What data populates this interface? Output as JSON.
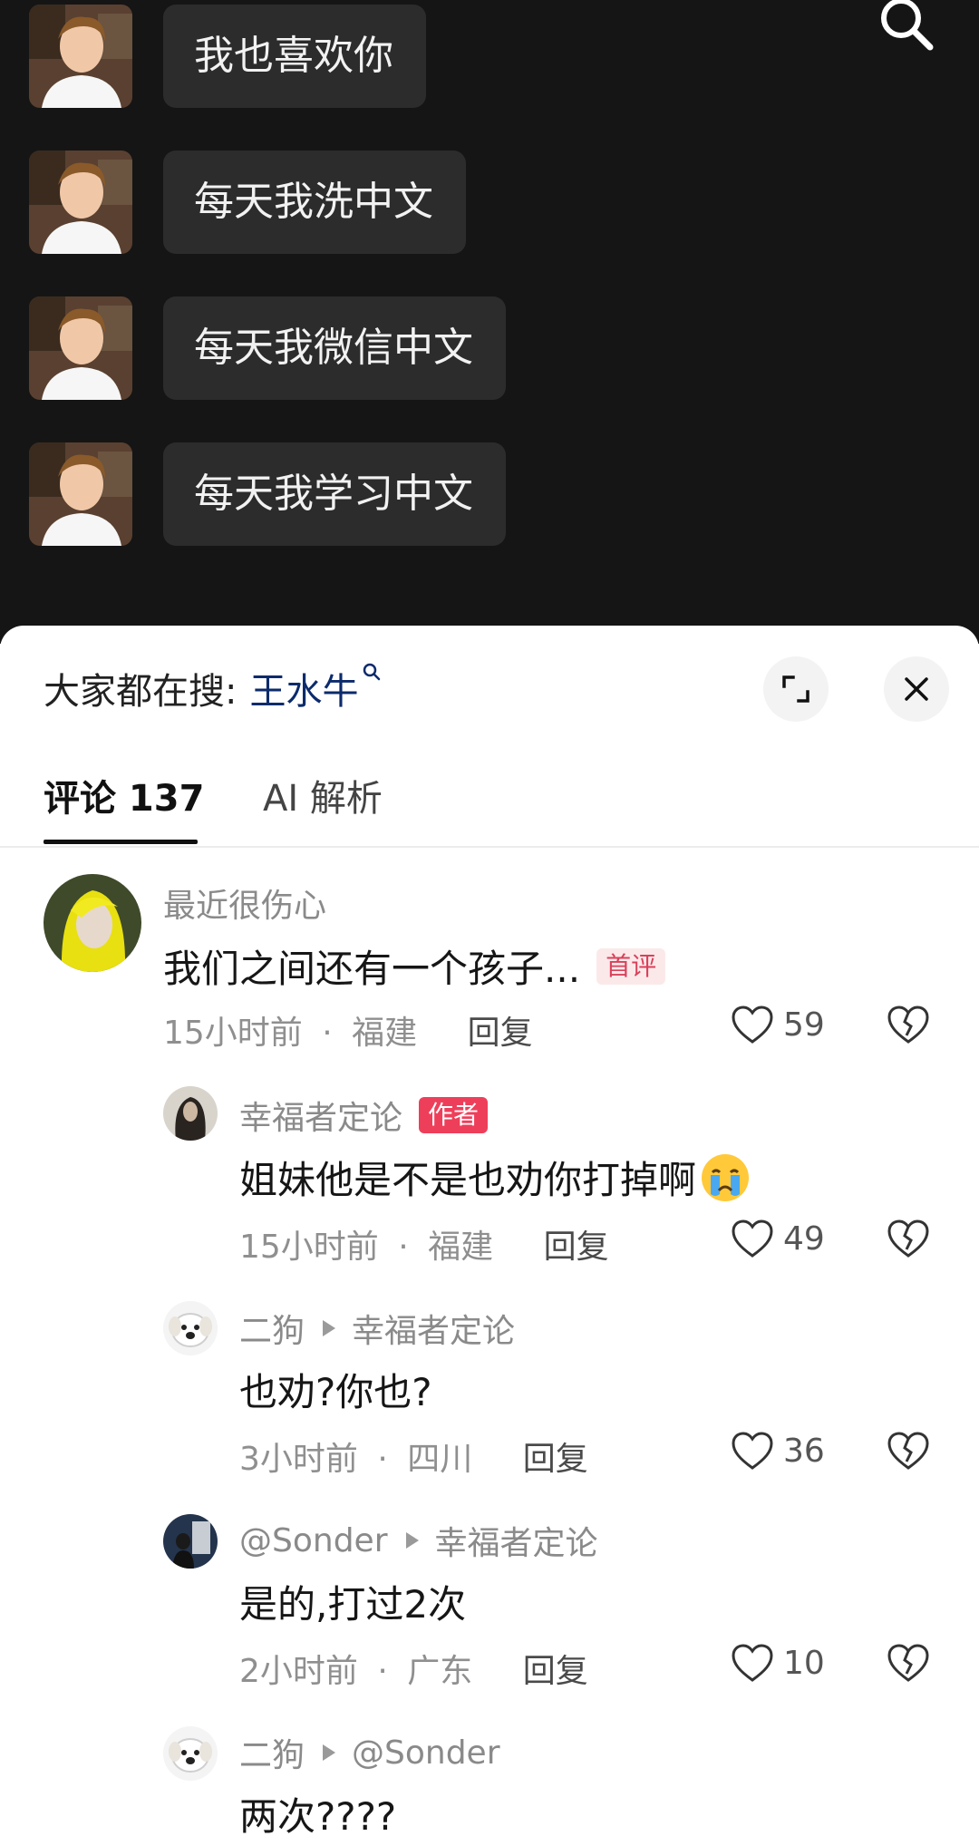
{
  "chat": {
    "messages": [
      {
        "text": "我也喜欢你"
      },
      {
        "text": "每天我洗中文"
      },
      {
        "text": "每天我微信中文"
      },
      {
        "text": "每天我学习中文"
      }
    ]
  },
  "hot_search": {
    "prefix": "大家都在搜:",
    "keyword": "王水牛"
  },
  "tabs": {
    "comments_label": "评论 137",
    "ai_label": "AI 解析"
  },
  "comments": [
    {
      "author": "最近很伤心",
      "text": "我们之间还有一个孩子...",
      "badge": "首评",
      "time": "15小时前",
      "location": "福建",
      "reply_label": "回复",
      "likes": "59"
    },
    {
      "author": "幸福者定论",
      "badge": "作者",
      "text": "姐妹他是不是也劝你打掉啊",
      "emoji": "crying-face",
      "time": "15小时前",
      "location": "福建",
      "reply_label": "回复",
      "likes": "49"
    },
    {
      "author": "二狗",
      "reply_to": "幸福者定论",
      "text": "也劝?你也?",
      "time": "3小时前",
      "location": "四川",
      "reply_label": "回复",
      "likes": "36"
    },
    {
      "author": "@Sonder",
      "reply_to": "幸福者定论",
      "text": "是的,打过2次",
      "time": "2小时前",
      "location": "广东",
      "reply_label": "回复",
      "likes": "10"
    },
    {
      "author": "二狗",
      "reply_to": "@Sonder",
      "text": "两次????"
    }
  ],
  "meta_separator": "·",
  "colors": {
    "video_bg": "#151515",
    "bubble_bg": "#2c2c2c",
    "badge_first": "#d9415a",
    "badge_author": "#ee3f5a",
    "keyword": "#0c2b6c"
  }
}
